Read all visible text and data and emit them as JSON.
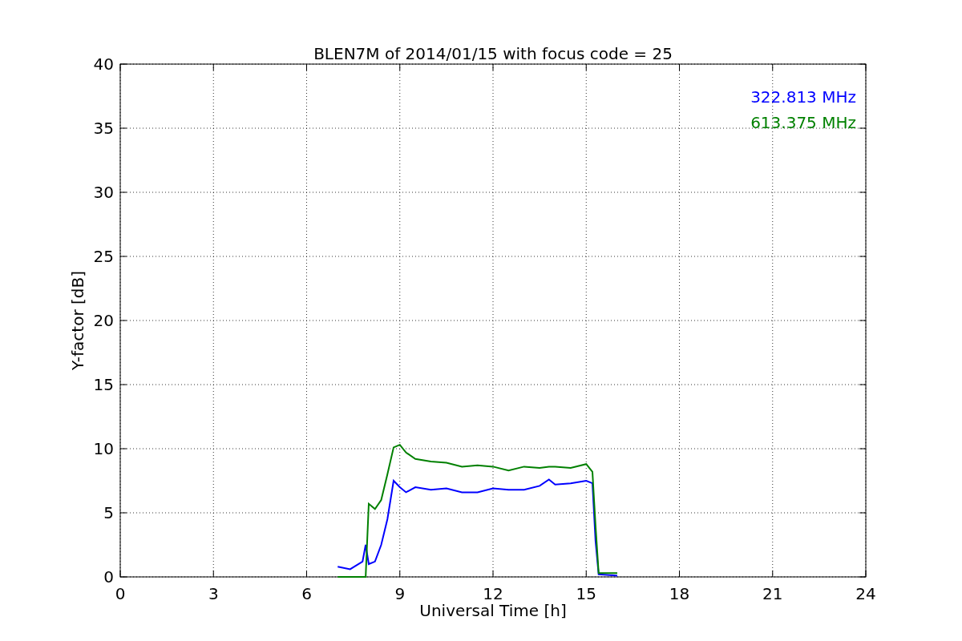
{
  "chart_data": {
    "type": "line",
    "title": "BLEN7M of 2014/01/15 with focus code = 25",
    "xlabel": "Universal Time [h]",
    "ylabel": "Y-factor [dB]",
    "x": [
      7.0,
      7.4,
      7.8,
      7.9,
      8.0,
      8.2,
      8.4,
      8.6,
      8.8,
      9.0,
      9.2,
      9.5,
      10,
      10.5,
      11,
      11.5,
      12,
      12.5,
      13,
      13.5,
      13.8,
      14,
      14.5,
      15,
      15.2,
      15.3,
      15.4,
      16
    ],
    "series": [
      {
        "name": "322.813 MHz",
        "color": "#0000ff",
        "values": [
          0.8,
          0.6,
          1.2,
          2.5,
          1.0,
          1.2,
          2.5,
          4.5,
          7.5,
          7.0,
          6.6,
          7.0,
          6.8,
          6.9,
          6.6,
          6.6,
          6.9,
          6.8,
          6.8,
          7.1,
          7.6,
          7.2,
          7.3,
          7.5,
          7.3,
          2.8,
          0.2,
          0.1
        ]
      },
      {
        "name": "613.375 MHz",
        "color": "#008000",
        "values": [
          0,
          0,
          0,
          0,
          5.7,
          5.3,
          6.0,
          8.0,
          10.1,
          10.3,
          9.7,
          9.2,
          9.0,
          8.9,
          8.6,
          8.7,
          8.6,
          8.3,
          8.6,
          8.5,
          8.6,
          8.6,
          8.5,
          8.8,
          8.2,
          4.0,
          0.3,
          0.3
        ]
      }
    ],
    "xlim": [
      0,
      24
    ],
    "ylim": [
      0,
      40
    ],
    "xticks": [
      0,
      3,
      6,
      9,
      12,
      15,
      18,
      21,
      24
    ],
    "yticks": [
      0,
      5,
      10,
      15,
      20,
      25,
      30,
      35,
      40
    ],
    "grid": true
  }
}
